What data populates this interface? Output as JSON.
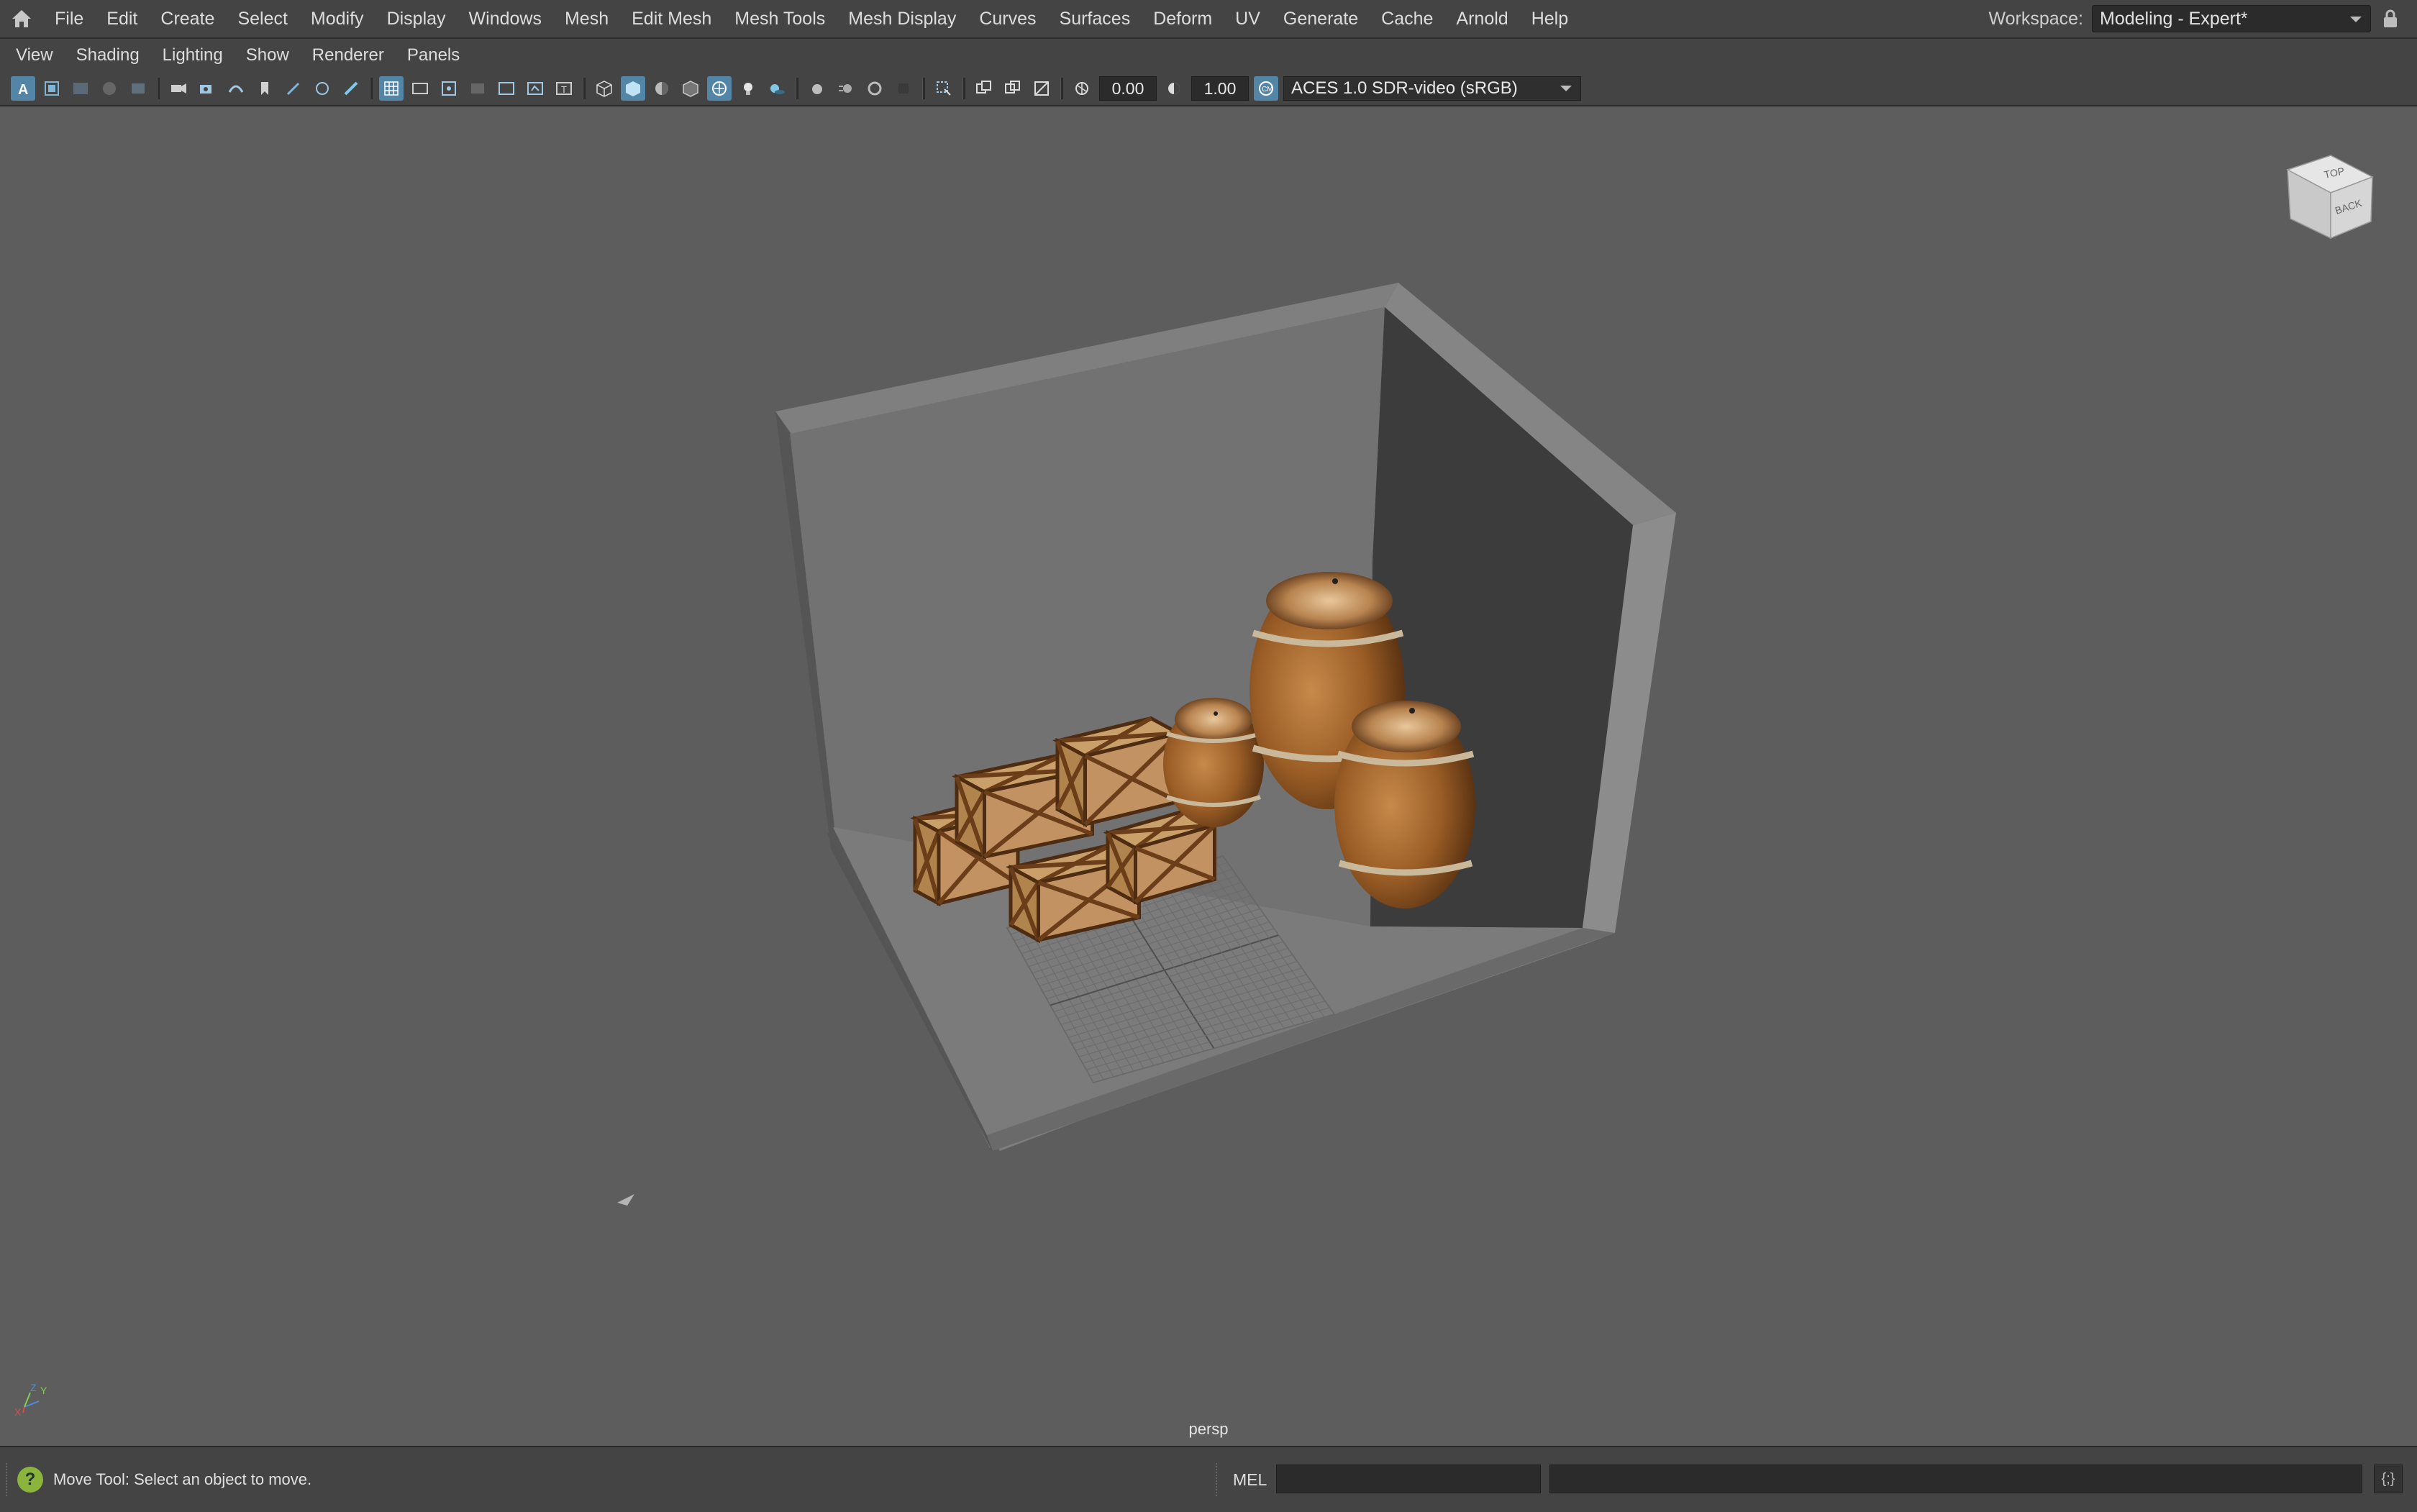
{
  "menubar": {
    "items": [
      "File",
      "Edit",
      "Create",
      "Select",
      "Modify",
      "Display",
      "Windows",
      "Mesh",
      "Edit Mesh",
      "Mesh Tools",
      "Mesh Display",
      "Curves",
      "Surfaces",
      "Deform",
      "UV",
      "Generate",
      "Cache",
      "Arnold",
      "Help"
    ],
    "workspace_label": "Workspace:",
    "workspace_value": "Modeling - Expert*"
  },
  "panel_menu": {
    "items": [
      "View",
      "Shading",
      "Lighting",
      "Show",
      "Renderer",
      "Panels"
    ]
  },
  "toolbar": {
    "exposure": "0.00",
    "gamma": "1.00",
    "color_management": "ACES 1.0 SDR-video (sRGB)"
  },
  "viewport": {
    "camera": "persp",
    "viewcube_faces": {
      "top": "TOP",
      "front": "BACK"
    },
    "axis_labels": {
      "y": "Y",
      "z": "Z",
      "x": "X"
    }
  },
  "command_line": {
    "help_text": "Move Tool: Select an object to move.",
    "language": "MEL"
  },
  "colors": {
    "accent": "#5285a6",
    "help_icon": "#8ab43c",
    "viewport_bg": "#5d5d5d",
    "ui_bg": "#444444"
  }
}
